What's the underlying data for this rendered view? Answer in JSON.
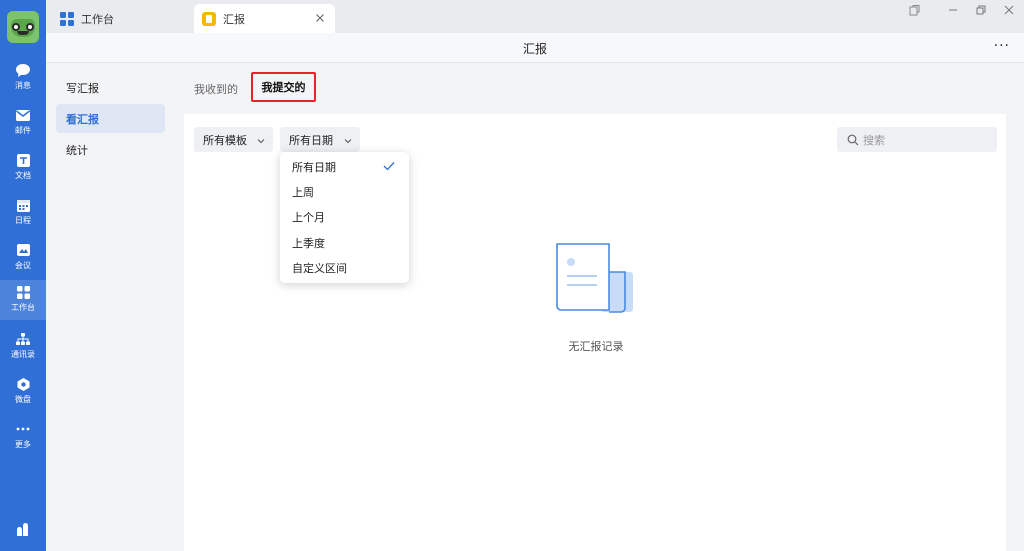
{
  "titlebar": {
    "tabs": [
      {
        "label": "工作台",
        "icon": "grid-app-icon"
      },
      {
        "label": "汇报",
        "icon": "report-app-icon"
      }
    ]
  },
  "rail": {
    "items": [
      {
        "label": "消息",
        "icon": "chat-bubble-icon"
      },
      {
        "label": "邮件",
        "icon": "mail-icon"
      },
      {
        "label": "文档",
        "icon": "document-icon"
      },
      {
        "label": "日程",
        "icon": "calendar-icon"
      },
      {
        "label": "会议",
        "icon": "meeting-icon"
      },
      {
        "label": "工作台",
        "icon": "workbench-grid-icon",
        "active": true
      },
      {
        "label": "通讯录",
        "icon": "org-chart-icon"
      },
      {
        "label": "微盘",
        "icon": "drive-icon"
      },
      {
        "label": "更多",
        "icon": "more-dots-icon"
      }
    ]
  },
  "header": {
    "title": "汇报",
    "more": "···"
  },
  "sidenav": {
    "items": [
      {
        "label": "写汇报"
      },
      {
        "label": "看汇报",
        "active": true
      },
      {
        "label": "统计"
      }
    ]
  },
  "subtabs": [
    {
      "label": "我收到的"
    },
    {
      "label": "我提交的",
      "active": true
    }
  ],
  "filters": {
    "template": {
      "label": "所有模板"
    },
    "date": {
      "label": "所有日期"
    }
  },
  "search": {
    "placeholder": "搜索"
  },
  "date_dropdown": {
    "options": [
      "所有日期",
      "上周",
      "上个月",
      "上季度",
      "自定义区间"
    ],
    "selected": "所有日期"
  },
  "empty_state": {
    "text": "无汇报记录"
  },
  "colors": {
    "rail": "#2f6fd6",
    "accent": "#2f6fd6",
    "highlight_box": "#e2262b",
    "tab_icon_yellow": "#f5b800"
  }
}
